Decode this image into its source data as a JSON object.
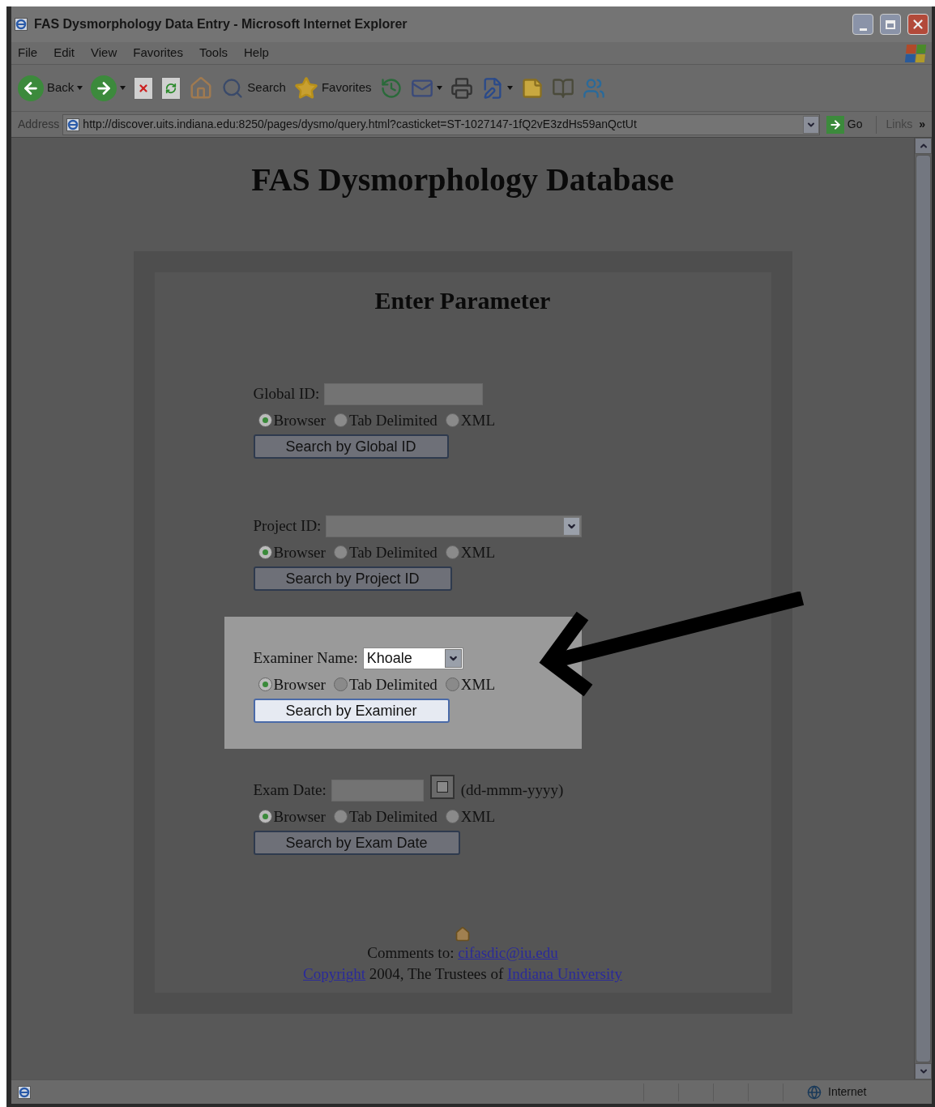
{
  "window": {
    "title": "FAS Dysmorphology Data Entry - Microsoft Internet Explorer"
  },
  "menu": [
    "File",
    "Edit",
    "View",
    "Favorites",
    "Tools",
    "Help"
  ],
  "toolbar": [
    {
      "kind": "back",
      "label": "Back"
    },
    {
      "kind": "forward"
    },
    {
      "kind": "stop"
    },
    {
      "kind": "refresh"
    },
    {
      "kind": "home"
    },
    {
      "kind": "search",
      "label": "Search"
    },
    {
      "kind": "favorites",
      "label": "Favorites"
    },
    {
      "kind": "history"
    },
    {
      "kind": "mail"
    },
    {
      "kind": "print"
    },
    {
      "kind": "edit"
    },
    {
      "kind": "note"
    },
    {
      "kind": "research"
    },
    {
      "kind": "messenger"
    }
  ],
  "address_bar": {
    "label": "Address",
    "url": "http://discover.uits.indiana.edu:8250/pages/dysmo/query.html?casticket=ST-1027147-1fQ2vE3zdHs59anQctUt",
    "go": "Go",
    "links": "Links",
    "links_more": "»"
  },
  "page": {
    "title": "FAS Dysmorphology Database",
    "form_heading": "Enter Parameter",
    "sections": [
      {
        "kind": "text",
        "label": "Global ID:",
        "highlighted": false,
        "formats": [
          {
            "label": "Browser",
            "selected": true
          },
          {
            "label": "Tab Delimited",
            "selected": false
          },
          {
            "label": "XML",
            "selected": false
          }
        ],
        "button": "Search by Global ID"
      },
      {
        "kind": "select",
        "label": "Project ID:",
        "highlighted": false,
        "formats": [
          {
            "label": "Browser",
            "selected": true
          },
          {
            "label": "Tab Delimited",
            "selected": false
          },
          {
            "label": "XML",
            "selected": false
          }
        ],
        "button": "Search by Project ID"
      },
      {
        "kind": "select",
        "label": "Examiner Name:",
        "value": "Khoale",
        "highlighted": true,
        "formats": [
          {
            "label": "Browser",
            "selected": true
          },
          {
            "label": "Tab Delimited",
            "selected": false
          },
          {
            "label": "XML",
            "selected": false
          }
        ],
        "button": "Search by Examiner"
      },
      {
        "kind": "date",
        "label": "Exam Date:",
        "hint": "(dd-mmm-yyyy)",
        "highlighted": false,
        "formats": [
          {
            "label": "Browser",
            "selected": true
          },
          {
            "label": "Tab Delimited",
            "selected": false
          },
          {
            "label": "XML",
            "selected": false
          }
        ],
        "button": "Search by Exam Date"
      }
    ],
    "footer": {
      "comments_label": "Comments to:",
      "email": "cifasdic@iu.edu",
      "copyright_link": "Copyright",
      "copyright_text": "2004, The Trustees of",
      "university": "Indiana University"
    }
  },
  "status_bar": {
    "zone": "Internet"
  }
}
